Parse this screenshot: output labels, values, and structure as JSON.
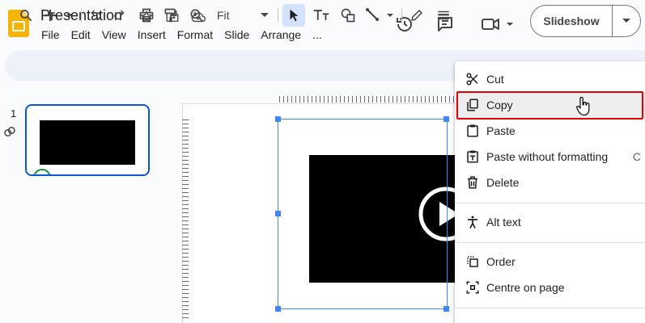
{
  "app": {
    "title": "Presentation",
    "menu": [
      "File",
      "Edit",
      "View",
      "Insert",
      "Format",
      "Slide",
      "Arrange",
      "..."
    ],
    "slideshow_label": "Slideshow"
  },
  "toolbar": {
    "zoom": "Fit"
  },
  "filmstrip": {
    "slide_number": "1"
  },
  "context_menu": {
    "items": [
      {
        "label": "Cut",
        "icon": "scissors-icon"
      },
      {
        "label": "Copy",
        "icon": "copy-icon"
      },
      {
        "label": "Paste",
        "icon": "clipboard-icon"
      },
      {
        "label": "Paste without formatting",
        "icon": "clipboard-text-icon",
        "shortcut": "C"
      },
      {
        "label": "Delete",
        "icon": "trash-icon"
      },
      {
        "label": "Alt text",
        "icon": "accessibility-icon"
      },
      {
        "label": "Order",
        "icon": "order-icon"
      },
      {
        "label": "Centre on page",
        "icon": "center-icon"
      }
    ]
  },
  "colors": {
    "accent": "#0b57d0",
    "selection": "#4285f4",
    "highlight": "#e00000",
    "logo": "#f4b400"
  }
}
